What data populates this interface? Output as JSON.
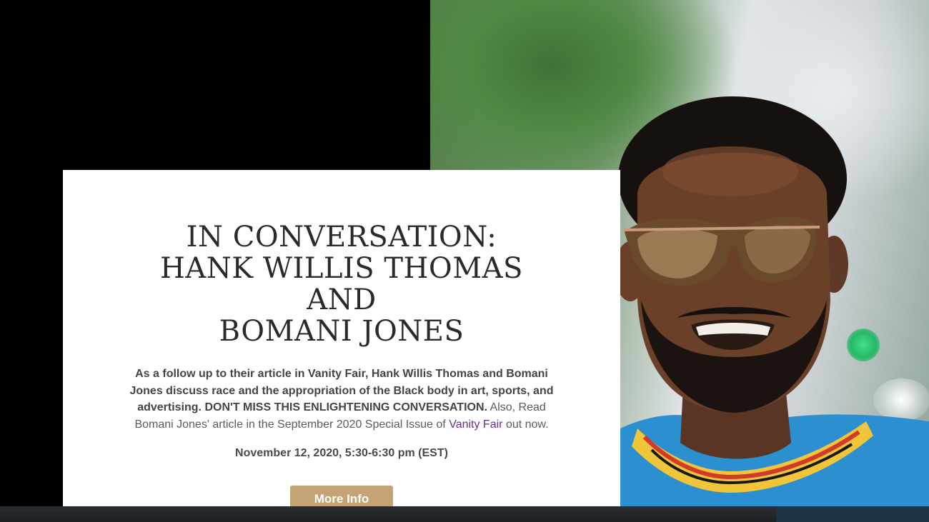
{
  "hero": {
    "title_line1": "IN CONVERSATION:",
    "title_line2": "HANK WILLIS THOMAS AND",
    "title_line3": "BOMANI JONES",
    "desc_bold": "As a follow up to their article in Vanity Fair, Hank Willis Thomas and Bomani Jones discuss race and the appropriation of the Black body in art, sports, and advertising. DON'T MISS THIS ENLIGHTENING CONVERSATION.",
    "desc_regular_before_link": "Also, Read Bomani Jones' article in the September 2020 Special Issue of",
    "desc_link": "Vanity Fair",
    "desc_regular_after_link": "out now.",
    "date": "November 12, 2020, 5:30-6:30 pm (EST)",
    "cta_label": "More Info"
  }
}
